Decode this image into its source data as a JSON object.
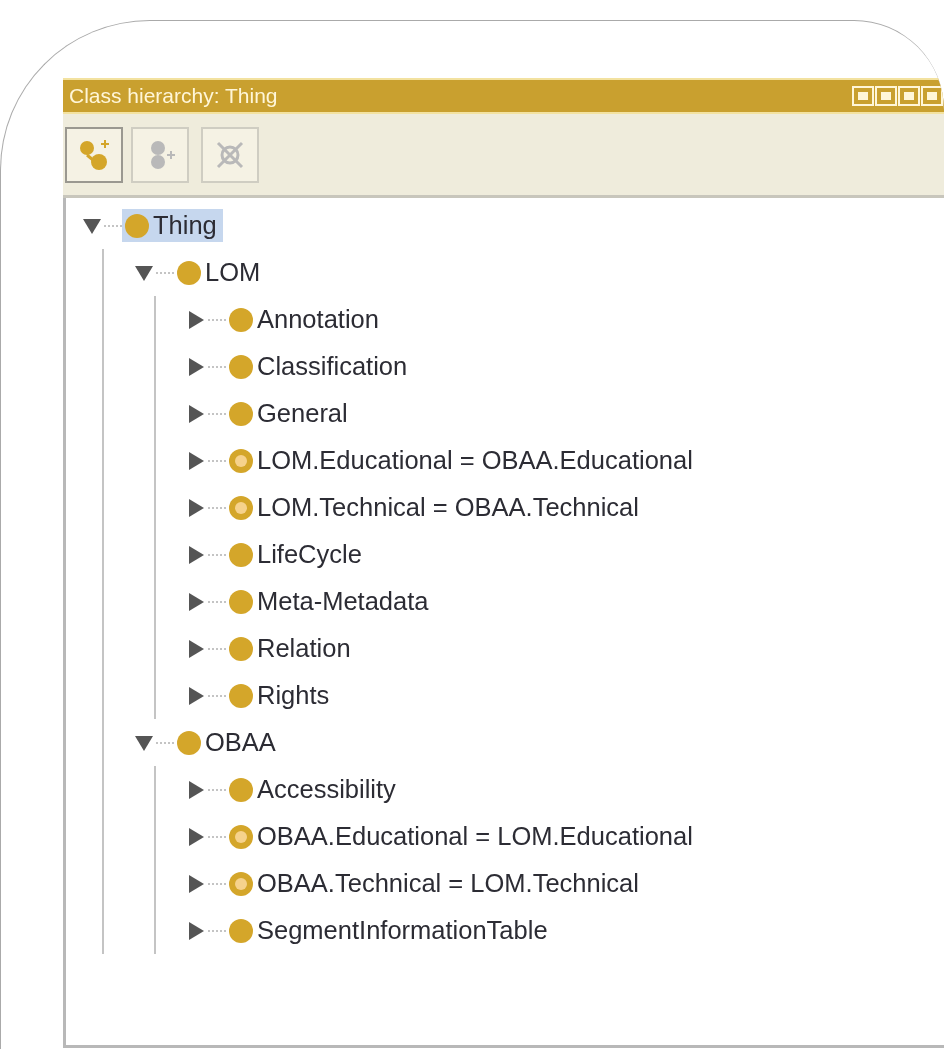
{
  "panel": {
    "title": "Class hierarchy: Thing",
    "toolbar": [
      {
        "kind": "subclass",
        "disabled": false
      },
      {
        "kind": "sibling",
        "disabled": true
      },
      {
        "kind": "delete",
        "disabled": true
      }
    ],
    "tree": [
      {
        "label": "Thing",
        "kind": "class",
        "expanded": true,
        "selected": true,
        "children": [
          {
            "label": "LOM",
            "kind": "class",
            "expanded": true,
            "selected": false,
            "children": [
              {
                "label": "Annotation",
                "kind": "class",
                "expanded": false,
                "selected": false
              },
              {
                "label": "Classification",
                "kind": "class",
                "expanded": false,
                "selected": false
              },
              {
                "label": "General",
                "kind": "class",
                "expanded": false,
                "selected": false
              },
              {
                "label": "LOM.Educational = OBAA.Educational",
                "kind": "equivalent",
                "expanded": false,
                "selected": false
              },
              {
                "label": "LOM.Technical = OBAA.Technical",
                "kind": "equivalent",
                "expanded": false,
                "selected": false
              },
              {
                "label": "LifeCycle",
                "kind": "class",
                "expanded": false,
                "selected": false
              },
              {
                "label": "Meta-Metadata",
                "kind": "class",
                "expanded": false,
                "selected": false
              },
              {
                "label": "Relation",
                "kind": "class",
                "expanded": false,
                "selected": false
              },
              {
                "label": "Rights",
                "kind": "class",
                "expanded": false,
                "selected": false
              }
            ]
          },
          {
            "label": "OBAA",
            "kind": "class",
            "expanded": true,
            "selected": false,
            "children": [
              {
                "label": "Accessibility",
                "kind": "class",
                "expanded": false,
                "selected": false
              },
              {
                "label": "OBAA.Educational = LOM.Educational",
                "kind": "equivalent",
                "expanded": false,
                "selected": false
              },
              {
                "label": "OBAA.Technical = LOM.Technical",
                "kind": "equivalent",
                "expanded": false,
                "selected": false
              },
              {
                "label": "SegmentInformationTable",
                "kind": "class",
                "expanded": false,
                "selected": false
              }
            ]
          }
        ]
      }
    ]
  }
}
